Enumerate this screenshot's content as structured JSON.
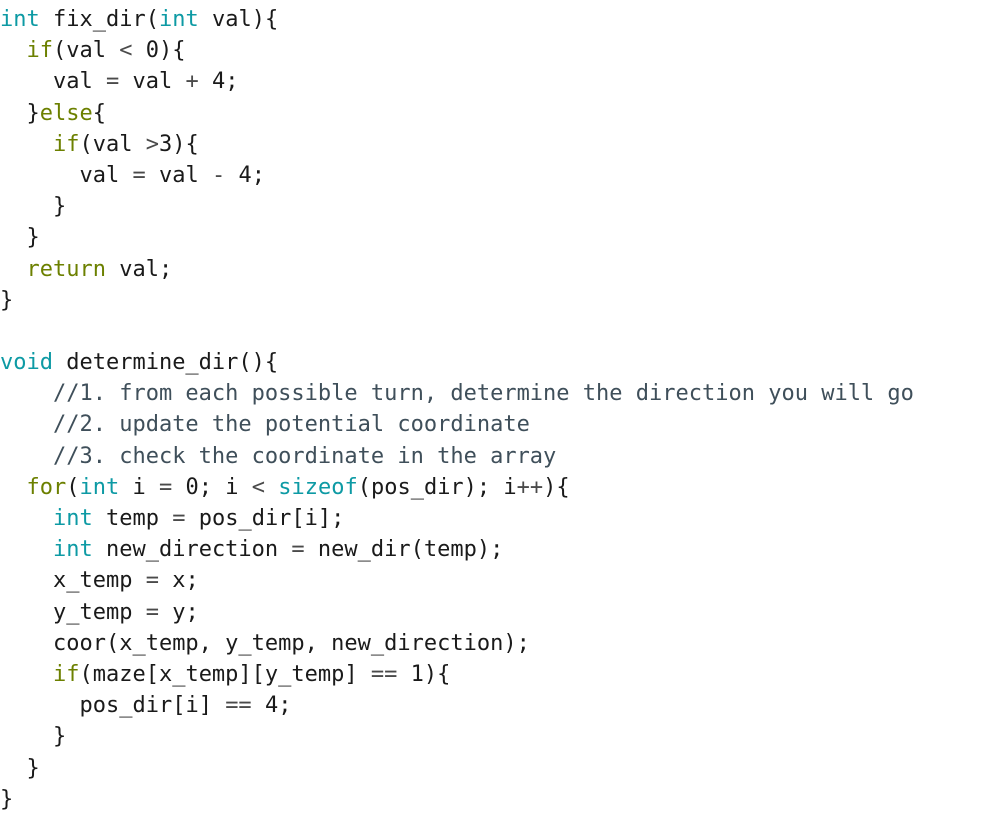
{
  "document": {
    "kind": "source-code-listing",
    "language": "c",
    "background_color": "#ffffff",
    "palette": {
      "plain": "#1a1a1a",
      "keyword_type": "#0d9aa4",
      "keyword_control": "#6c8000",
      "comment": "#3f4f5a",
      "operator": "#4a4a4a",
      "number": "#1a1a1a"
    },
    "lines": [
      {
        "indent": 0,
        "tokens": [
          {
            "t": "int",
            "c": "keyword"
          },
          {
            "t": " fix_dir(",
            "c": "plain"
          },
          {
            "t": "int",
            "c": "keyword"
          },
          {
            "t": " val){",
            "c": "plain"
          }
        ]
      },
      {
        "indent": 2,
        "tokens": [
          {
            "t": "if",
            "c": "control"
          },
          {
            "t": "(val ",
            "c": "plain"
          },
          {
            "t": "<",
            "c": "op"
          },
          {
            "t": " ",
            "c": "plain"
          },
          {
            "t": "0",
            "c": "num"
          },
          {
            "t": "){",
            "c": "plain"
          }
        ]
      },
      {
        "indent": 4,
        "tokens": [
          {
            "t": "val ",
            "c": "plain"
          },
          {
            "t": "=",
            "c": "op"
          },
          {
            "t": " val ",
            "c": "plain"
          },
          {
            "t": "+",
            "c": "op"
          },
          {
            "t": " ",
            "c": "plain"
          },
          {
            "t": "4",
            "c": "num"
          },
          {
            "t": ";",
            "c": "plain"
          }
        ]
      },
      {
        "indent": 2,
        "tokens": [
          {
            "t": "}",
            "c": "plain"
          },
          {
            "t": "else",
            "c": "control"
          },
          {
            "t": "{",
            "c": "plain"
          }
        ]
      },
      {
        "indent": 4,
        "tokens": [
          {
            "t": "if",
            "c": "control"
          },
          {
            "t": "(val ",
            "c": "plain"
          },
          {
            "t": ">",
            "c": "op"
          },
          {
            "t": "3",
            "c": "num"
          },
          {
            "t": "){",
            "c": "plain"
          }
        ]
      },
      {
        "indent": 6,
        "tokens": [
          {
            "t": "val ",
            "c": "plain"
          },
          {
            "t": "=",
            "c": "op"
          },
          {
            "t": " val ",
            "c": "plain"
          },
          {
            "t": "-",
            "c": "op"
          },
          {
            "t": " ",
            "c": "plain"
          },
          {
            "t": "4",
            "c": "num"
          },
          {
            "t": ";",
            "c": "plain"
          }
        ]
      },
      {
        "indent": 4,
        "tokens": [
          {
            "t": "}",
            "c": "plain"
          }
        ]
      },
      {
        "indent": 2,
        "tokens": [
          {
            "t": "}",
            "c": "plain"
          }
        ]
      },
      {
        "indent": 2,
        "tokens": [
          {
            "t": "return",
            "c": "control"
          },
          {
            "t": " val;",
            "c": "plain"
          }
        ]
      },
      {
        "indent": 0,
        "tokens": [
          {
            "t": "}",
            "c": "plain"
          }
        ]
      },
      {
        "indent": 0,
        "tokens": []
      },
      {
        "indent": 0,
        "tokens": [
          {
            "t": "void",
            "c": "keyword"
          },
          {
            "t": " determine_dir(){",
            "c": "plain"
          }
        ]
      },
      {
        "indent": 4,
        "tokens": [
          {
            "t": "//1. from each possible turn, determine the direction you will go",
            "c": "comment"
          }
        ]
      },
      {
        "indent": 4,
        "tokens": [
          {
            "t": "//2. update the potential coordinate",
            "c": "comment"
          }
        ]
      },
      {
        "indent": 4,
        "tokens": [
          {
            "t": "//3. check the coordinate in the array",
            "c": "comment"
          }
        ]
      },
      {
        "indent": 2,
        "tokens": [
          {
            "t": "for",
            "c": "control"
          },
          {
            "t": "(",
            "c": "plain"
          },
          {
            "t": "int",
            "c": "keyword"
          },
          {
            "t": " i ",
            "c": "plain"
          },
          {
            "t": "=",
            "c": "op"
          },
          {
            "t": " ",
            "c": "plain"
          },
          {
            "t": "0",
            "c": "num"
          },
          {
            "t": "; i ",
            "c": "plain"
          },
          {
            "t": "<",
            "c": "op"
          },
          {
            "t": " ",
            "c": "plain"
          },
          {
            "t": "sizeof",
            "c": "keyword"
          },
          {
            "t": "(pos_dir); i",
            "c": "plain"
          },
          {
            "t": "++",
            "c": "op"
          },
          {
            "t": "){",
            "c": "plain"
          }
        ]
      },
      {
        "indent": 4,
        "tokens": [
          {
            "t": "int",
            "c": "keyword"
          },
          {
            "t": " temp ",
            "c": "plain"
          },
          {
            "t": "=",
            "c": "op"
          },
          {
            "t": " pos_dir[i];",
            "c": "plain"
          }
        ]
      },
      {
        "indent": 4,
        "tokens": [
          {
            "t": "int",
            "c": "keyword"
          },
          {
            "t": " new_direction ",
            "c": "plain"
          },
          {
            "t": "=",
            "c": "op"
          },
          {
            "t": " new_dir(temp);",
            "c": "plain"
          }
        ]
      },
      {
        "indent": 4,
        "tokens": [
          {
            "t": "x_temp ",
            "c": "plain"
          },
          {
            "t": "=",
            "c": "op"
          },
          {
            "t": " x;",
            "c": "plain"
          }
        ]
      },
      {
        "indent": 4,
        "tokens": [
          {
            "t": "y_temp ",
            "c": "plain"
          },
          {
            "t": "=",
            "c": "op"
          },
          {
            "t": " y;",
            "c": "plain"
          }
        ]
      },
      {
        "indent": 4,
        "tokens": [
          {
            "t": "coor(x_temp, y_temp, new_direction);",
            "c": "plain"
          }
        ]
      },
      {
        "indent": 4,
        "tokens": [
          {
            "t": "if",
            "c": "control"
          },
          {
            "t": "(maze[x_temp][y_temp] ",
            "c": "plain"
          },
          {
            "t": "==",
            "c": "op"
          },
          {
            "t": " ",
            "c": "plain"
          },
          {
            "t": "1",
            "c": "num"
          },
          {
            "t": "){",
            "c": "plain"
          }
        ]
      },
      {
        "indent": 6,
        "tokens": [
          {
            "t": "pos_dir[i] ",
            "c": "plain"
          },
          {
            "t": "==",
            "c": "op"
          },
          {
            "t": " ",
            "c": "plain"
          },
          {
            "t": "4",
            "c": "num"
          },
          {
            "t": ";",
            "c": "plain"
          }
        ]
      },
      {
        "indent": 4,
        "tokens": [
          {
            "t": "}",
            "c": "plain"
          }
        ]
      },
      {
        "indent": 2,
        "tokens": [
          {
            "t": "}",
            "c": "plain"
          }
        ]
      },
      {
        "indent": 0,
        "tokens": [
          {
            "t": "}",
            "c": "plain"
          }
        ]
      }
    ],
    "plain_text": "int fix_dir(int val){\n  if(val < 0){\n    val = val + 4;\n  }else{\n    if(val >3){\n      val = val - 4;\n    }\n  }\n  return val;\n}\n\nvoid determine_dir(){\n    //1. from each possible turn, determine the direction you will go\n    //2. update the potential coordinate\n    //3. check the coordinate in the array\n  for(int i = 0; i < sizeof(pos_dir); i++){\n    int temp = pos_dir[i];\n    int new_direction = new_dir(temp);\n    x_temp = x;\n    y_temp = y;\n    coor(x_temp, y_temp, new_direction);\n    if(maze[x_temp][y_temp] == 1){\n      pos_dir[i] == 4;\n    }\n  }\n}"
  }
}
